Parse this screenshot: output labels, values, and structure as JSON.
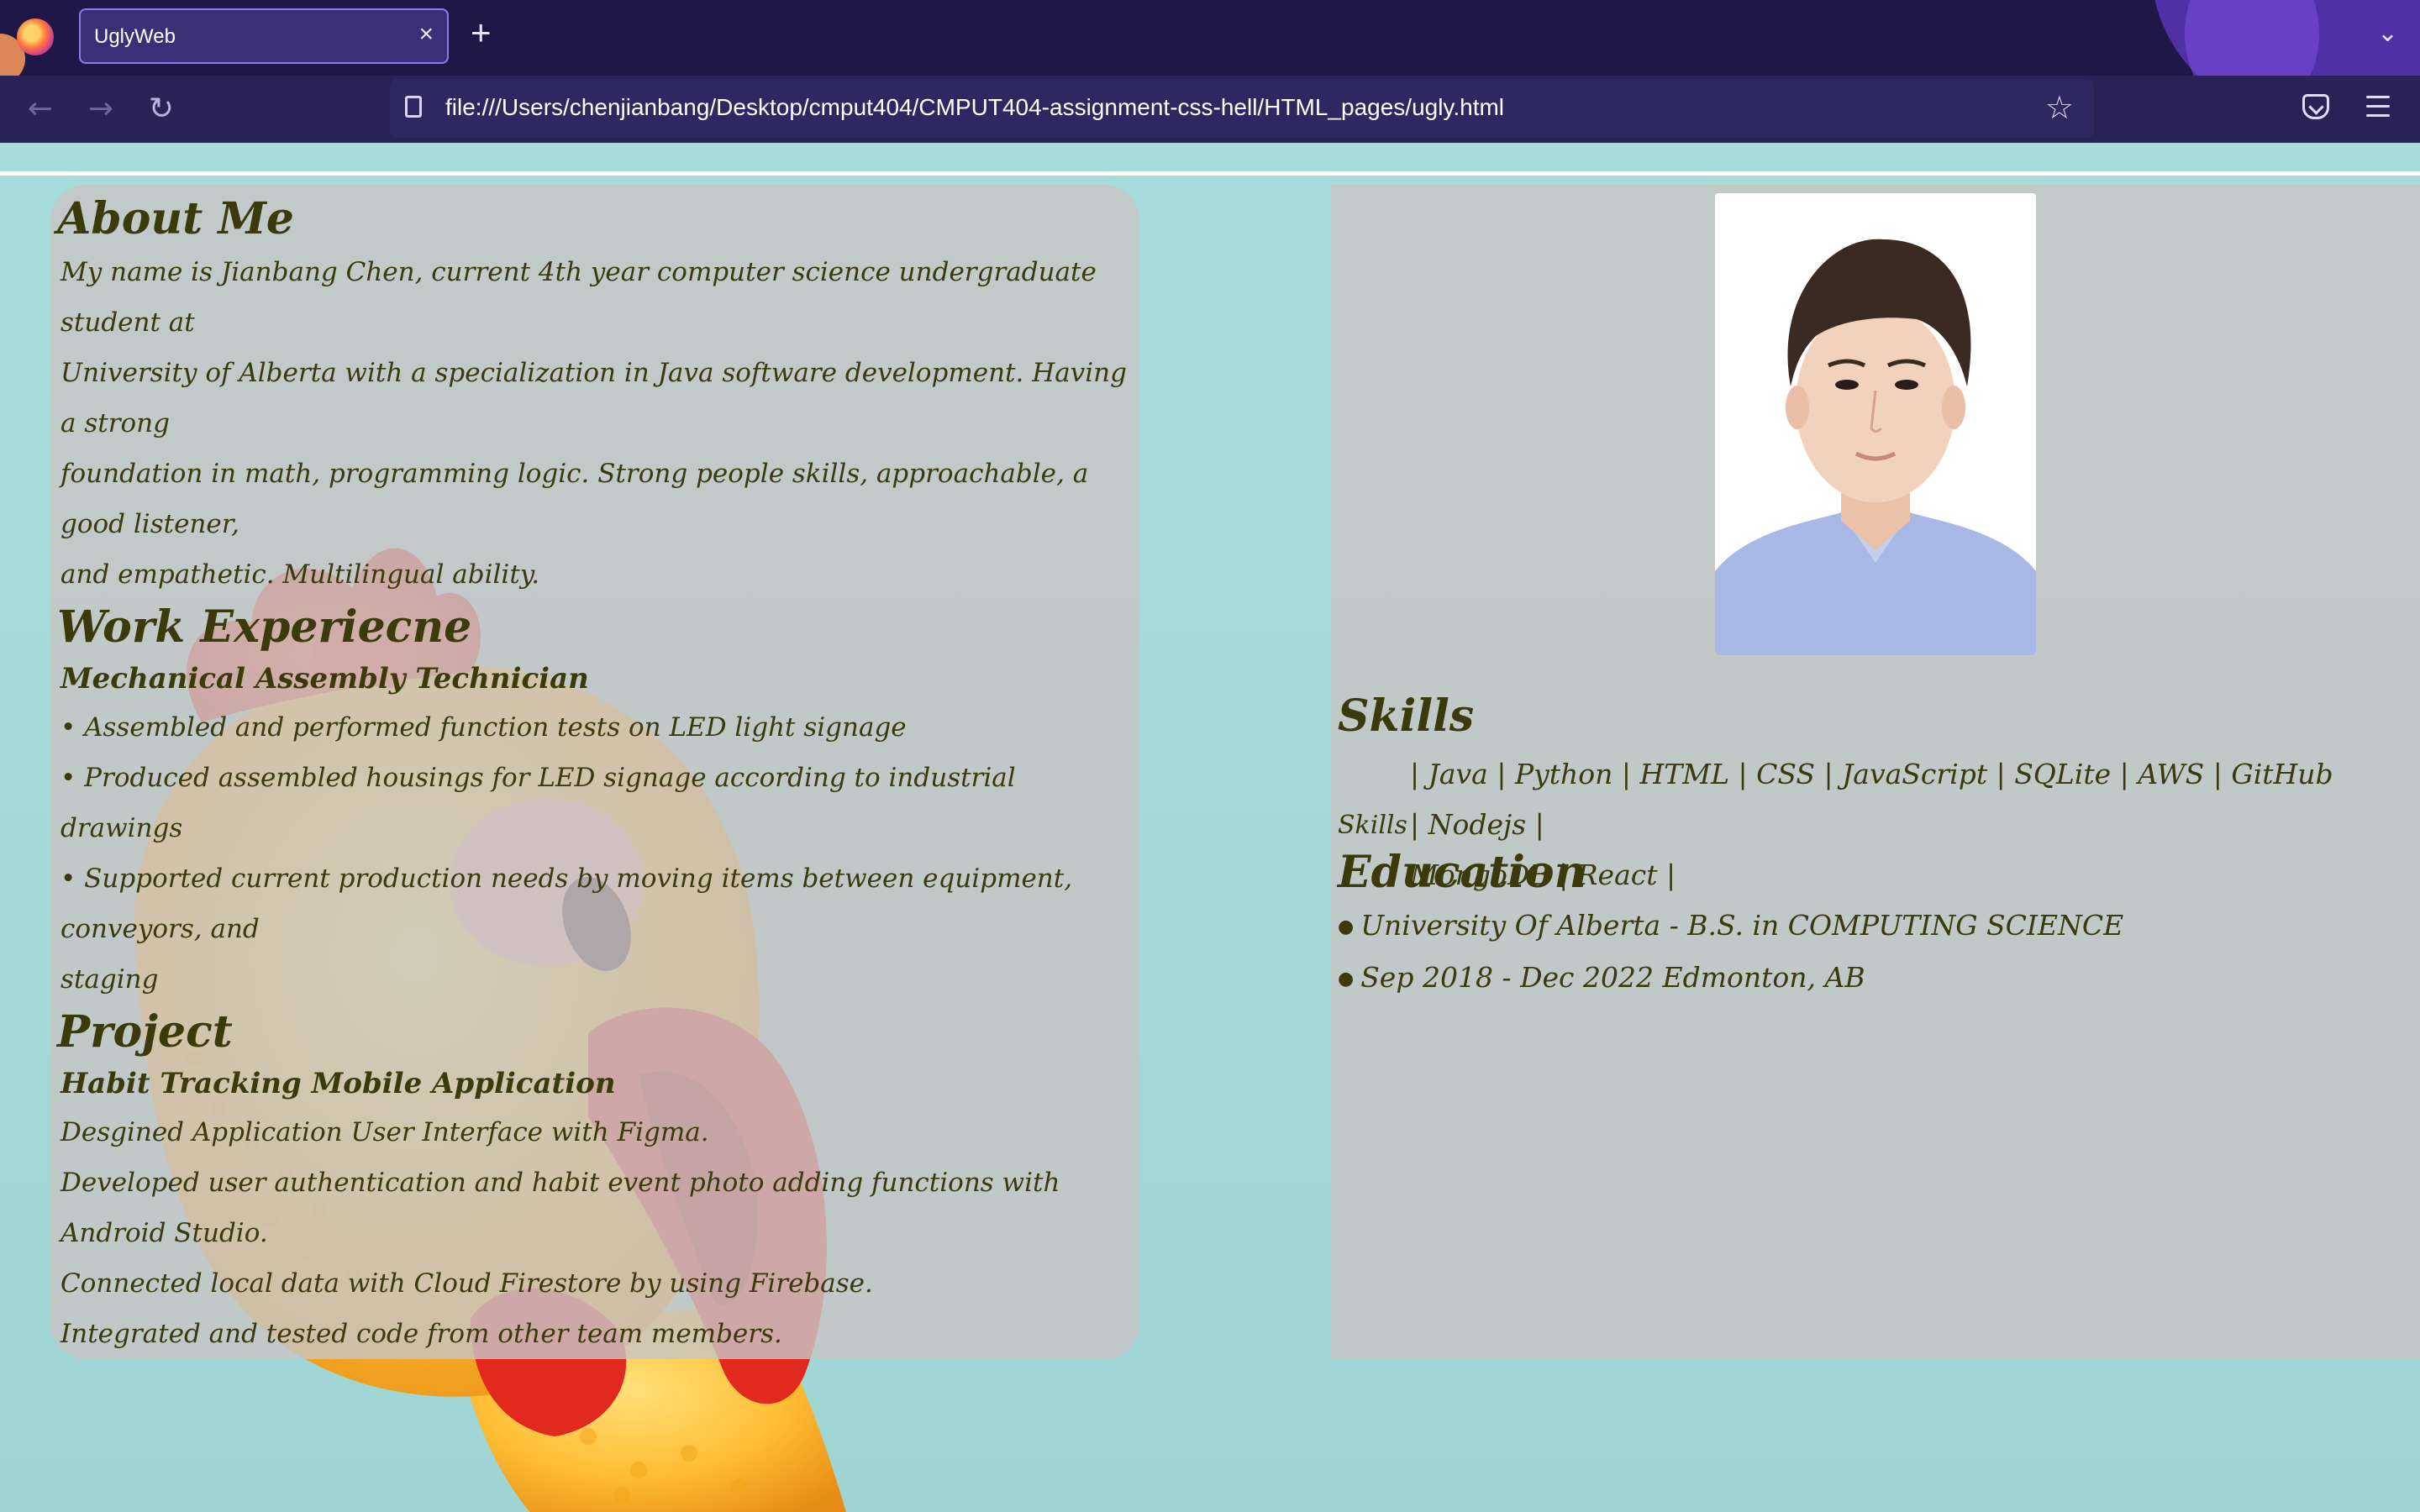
{
  "browser": {
    "tab_title": "UglyWeb",
    "tab_close": "×",
    "new_tab": "+",
    "tab_list": "⌄",
    "back": "←",
    "forward": "→",
    "reload": "↻",
    "url": "file:///Users/chenjianbang/Desktop/cmput404/CMPUT404-assignment-css-hell/HTML_pages/ugly.html",
    "bookmark": "☆"
  },
  "about": {
    "heading": "About Me",
    "lines": [
      "My name is Jianbang Chen, current 4th year computer science undergraduate student at",
      "University of Alberta with a specialization in Java software development. Having a strong",
      "foundation in math, programming logic. Strong people skills, approachable, a good listener,",
      "and empathetic. Multilingual ability."
    ]
  },
  "work": {
    "heading": "Work Experiecne",
    "job_title": "Mechanical Assembly Technician",
    "lines": [
      "• Assembled and performed function tests on LED light signage",
      "• Produced assembled housings for LED signage according to industrial drawings",
      "• Supported current production needs by moving items between equipment, conveyors, and",
      "staging"
    ]
  },
  "project": {
    "heading": "Project",
    "name": "Habit Tracking Mobile Application",
    "lines": [
      "Desgined Application User Interface with Figma.",
      "Developed user authentication and habit event photo adding functions with Android Studio.",
      "Connected local data with Cloud Firestore by using Firebase.",
      "Integrated and tested code from other team members."
    ]
  },
  "skills": {
    "heading": "Skills",
    "label": "Skills",
    "line1": "| Java | Python | HTML | CSS | JavaScript | SQLite | AWS | GitHub | Nodejs |",
    "line2": "MongoDB | React |"
  },
  "education": {
    "heading": "Education",
    "items": [
      "University Of Alberta - B.S. in COMPUTING SCIENCE",
      "Sep 2018 - Dec 2022 Edmonton, AB"
    ]
  },
  "colors": {
    "page_bg": "#a9dedd",
    "panel": "#c8c4c4",
    "text": "#3a3a0c",
    "chrome": "#1f1745"
  }
}
